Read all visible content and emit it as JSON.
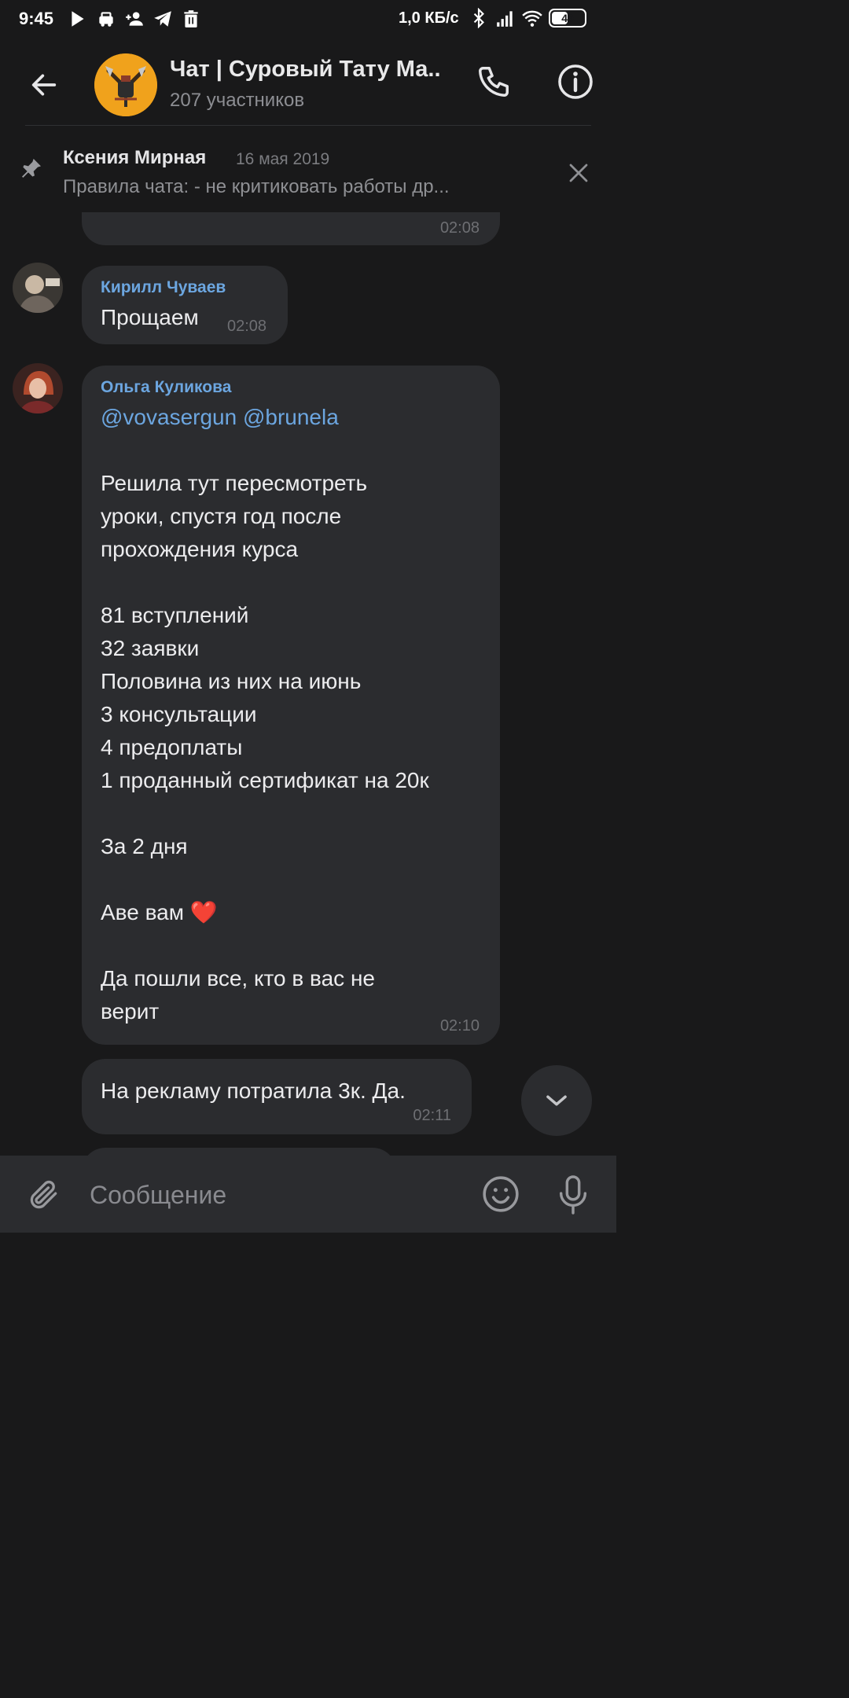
{
  "status_bar": {
    "time": "9:45",
    "left_icons": [
      "play-store-icon",
      "car-icon",
      "add-user-icon",
      "telegram-icon",
      "trash-icon"
    ],
    "speed": "1,0 КБ/с",
    "right_icons": [
      "bluetooth-icon",
      "signal-icon",
      "wifi-icon"
    ],
    "battery": "49",
    "battery_level": 0.49
  },
  "header": {
    "back_icon": "arrow-left-icon",
    "title": "Чат | Суровый Тату Ма..",
    "subtitle": "207 участников",
    "call_icon": "phone-icon",
    "info_icon": "info-icon"
  },
  "pinned": {
    "icon": "pin-icon",
    "author": "Ксения Мирная",
    "date": "16 мая 2019",
    "text": "Правила чата:  - не критиковать работы др...",
    "close_icon": "close-icon"
  },
  "messages": [
    {
      "time": "02:08"
    },
    {
      "author": "Кирилл Чуваев",
      "text": "Прощаем",
      "time": "02:08"
    },
    {
      "author": "Ольга Куликова",
      "mentions": "@vovasergun @brunela",
      "text": "Решила тут пересмотреть\nуроки, спустя год после\nпрохождения курса\n\n81 вступлений\n32 заявки\nПоловина из них на июнь\n3 консультации\n4 предоплаты\n1 проданный сертификат на 20к\n\nЗа 2 дня\n\nАве вам ❤️\n\nДа пошли все, кто в вас не\nверит",
      "time": "02:10"
    },
    {
      "text": "На рекламу потратила 3к. Да.",
      "time": "02:11"
    }
  ],
  "composer": {
    "placeholder": "Сообщение",
    "attach_icon": "paperclip-icon",
    "emoji_icon": "smile-icon",
    "mic_icon": "microphone-icon"
  },
  "colors": {
    "background": "#19191a",
    "bubble": "#2b2c2f",
    "accent_name": "#6ca6e0",
    "avatar_chat": "#f0a21c"
  }
}
